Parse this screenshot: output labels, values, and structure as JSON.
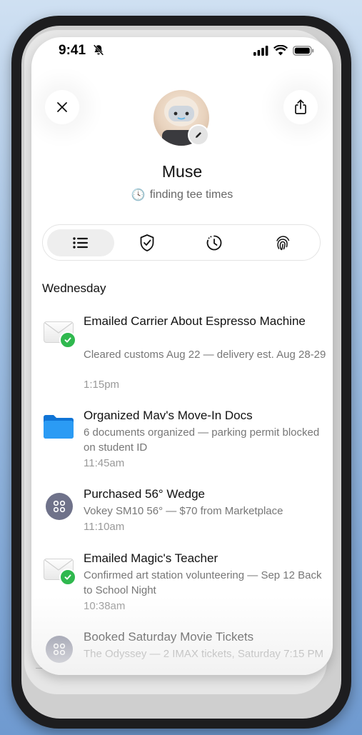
{
  "status_bar": {
    "time": "9:41"
  },
  "profile": {
    "name": "Muse",
    "status_emoji": "🕓",
    "status_text": "finding tee times"
  },
  "tabs": [
    {
      "icon": "list-icon",
      "active": true
    },
    {
      "icon": "shield-check-icon",
      "active": false
    },
    {
      "icon": "history-icon",
      "active": false
    },
    {
      "icon": "fingerprint-icon",
      "active": false
    }
  ],
  "activity": {
    "day_label": "Wednesday",
    "items": [
      {
        "icon": "mail-check-icon",
        "title": "Emailed Carrier About Espresso Machine",
        "desc": "Cleared customs Aug 22 — delivery est. Aug 28-29",
        "time": "1:15pm"
      },
      {
        "icon": "folder-icon",
        "title": "Organized Mav's Move-In Docs",
        "desc": "6 documents organized — parking permit blocked on student ID",
        "time": "11:45am"
      },
      {
        "icon": "command-icon",
        "title": "Purchased 56° Wedge",
        "desc": "Vokey SM10 56° — $70 from Marketplace",
        "time": "11:10am"
      },
      {
        "icon": "mail-check-icon",
        "title": "Emailed Magic's Teacher",
        "desc": "Confirmed art station volunteering — Sep 12 Back to School Night",
        "time": "10:38am"
      },
      {
        "icon": "command-icon",
        "title": "Booked Saturday Movie Tickets",
        "desc": "The Odyssey — 2 IMAX tickets, Saturday 7:15 PM",
        "time": ""
      }
    ]
  },
  "colors": {
    "check_green": "#2fb84e",
    "folder_blue": "#1e8ff0",
    "app_circle": "#6f728a"
  }
}
